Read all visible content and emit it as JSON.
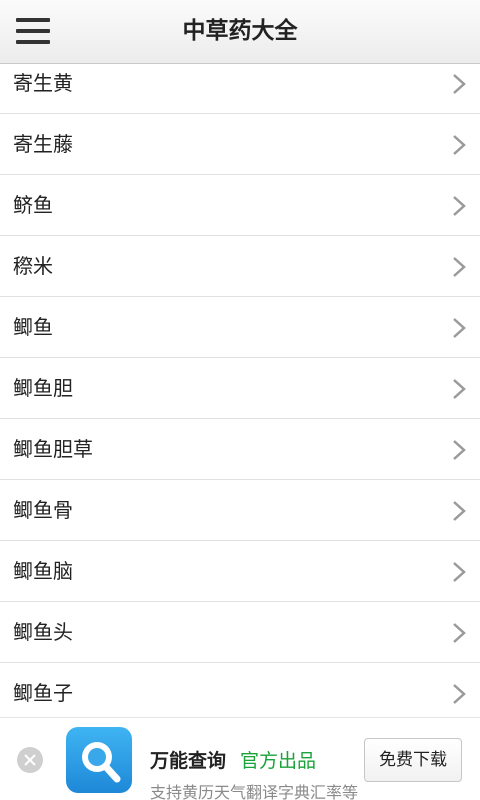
{
  "header": {
    "title": "中草药大全",
    "menu_icon": "hamburger-menu-icon"
  },
  "list": {
    "items": [
      {
        "label": "寄生黄"
      },
      {
        "label": "寄生藤"
      },
      {
        "label": "鲚鱼"
      },
      {
        "label": "穄米"
      },
      {
        "label": "鲫鱼"
      },
      {
        "label": "鲫鱼胆"
      },
      {
        "label": "鲫鱼胆草"
      },
      {
        "label": "鲫鱼骨"
      },
      {
        "label": "鲫鱼脑"
      },
      {
        "label": "鲫鱼头"
      },
      {
        "label": "鲫鱼子"
      }
    ],
    "row_icon": "chevron-right-icon"
  },
  "ad": {
    "app_name": "万能查询",
    "official_text": "官方出品",
    "subtitle": "支持黄历天气翻译字典汇率等",
    "download_label": "免费下载",
    "close_icon": "close-icon",
    "logo_icon": "magnifier-icon",
    "accent_color": "#1aa33a",
    "logo_color": "#1e88d8"
  }
}
